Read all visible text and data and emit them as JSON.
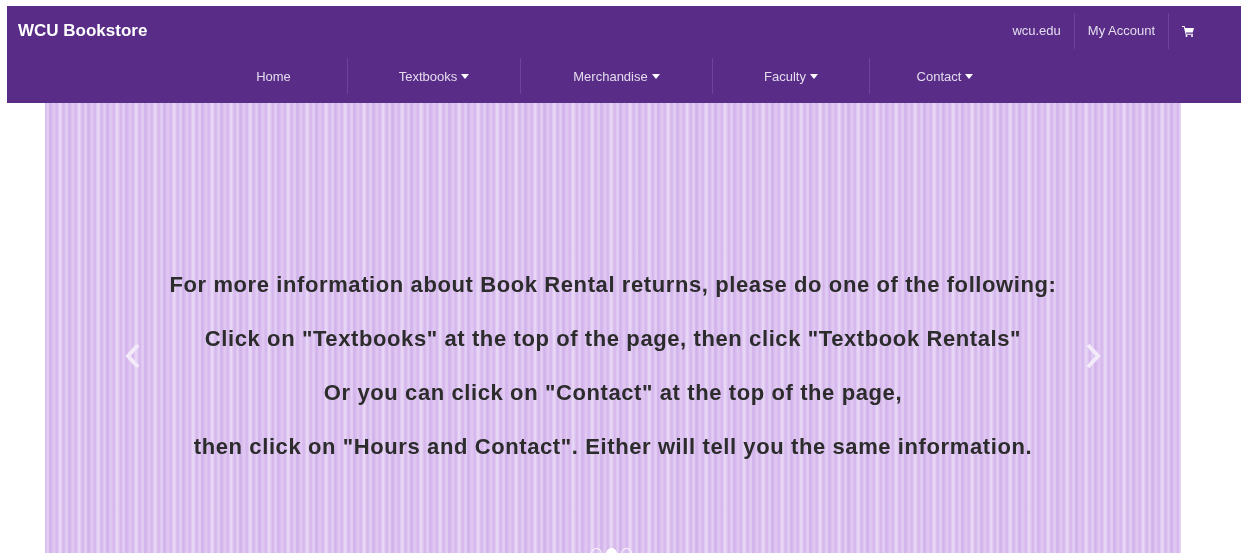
{
  "brand": "WCU Bookstore",
  "top_links": [
    {
      "kind": "text",
      "label": "wcu.edu"
    },
    {
      "kind": "text",
      "label": "My Account"
    },
    {
      "kind": "cart"
    }
  ],
  "nav": [
    {
      "label": "Home",
      "dropdown": false
    },
    {
      "label": "Textbooks",
      "dropdown": true
    },
    {
      "label": "Merchandise",
      "dropdown": true
    },
    {
      "label": "Faculty",
      "dropdown": true
    },
    {
      "label": "Contact",
      "dropdown": true
    }
  ],
  "slide": {
    "lines": [
      "For more information about Book Rental returns, please do one of the following:",
      "Click on \"Textbooks\" at the top of the page, then click \"Textbook Rentals\"",
      "Or you can click on \"Contact\" at the top of the page,",
      "then click on \"Hours and Contact\". Either will tell you the same information."
    ]
  },
  "indicators": [
    {
      "selected": false
    },
    {
      "selected": true
    },
    {
      "selected": false
    }
  ]
}
